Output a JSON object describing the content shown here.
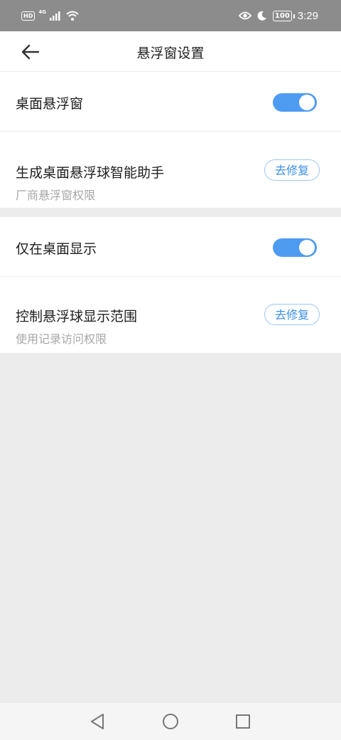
{
  "status_bar": {
    "hd_label": "HD",
    "network_label": "4G",
    "time": "3:29",
    "battery": "100"
  },
  "header": {
    "title": "悬浮窗设置",
    "back_icon": "arrow-left-icon"
  },
  "settings": [
    {
      "title": "桌面悬浮窗",
      "control": "toggle",
      "enabled": true
    },
    {
      "title": "生成桌面悬浮球智能助手",
      "subtitle": "厂商悬浮窗权限",
      "control": "button",
      "button_label": "去修复"
    },
    {
      "title": "仅在桌面显示",
      "control": "toggle",
      "enabled": true
    },
    {
      "title": "控制悬浮球显示范围",
      "subtitle": "使用记录访问权限",
      "control": "button",
      "button_label": "去修复"
    }
  ],
  "colors": {
    "accent": "#4e9bf2",
    "button_text": "#3a8ee6",
    "status_bar": "#8c8c8c",
    "background": "#ececec"
  },
  "nav_bar": {
    "icons": [
      "back-triangle-icon",
      "home-circle-icon",
      "recents-square-icon"
    ]
  }
}
